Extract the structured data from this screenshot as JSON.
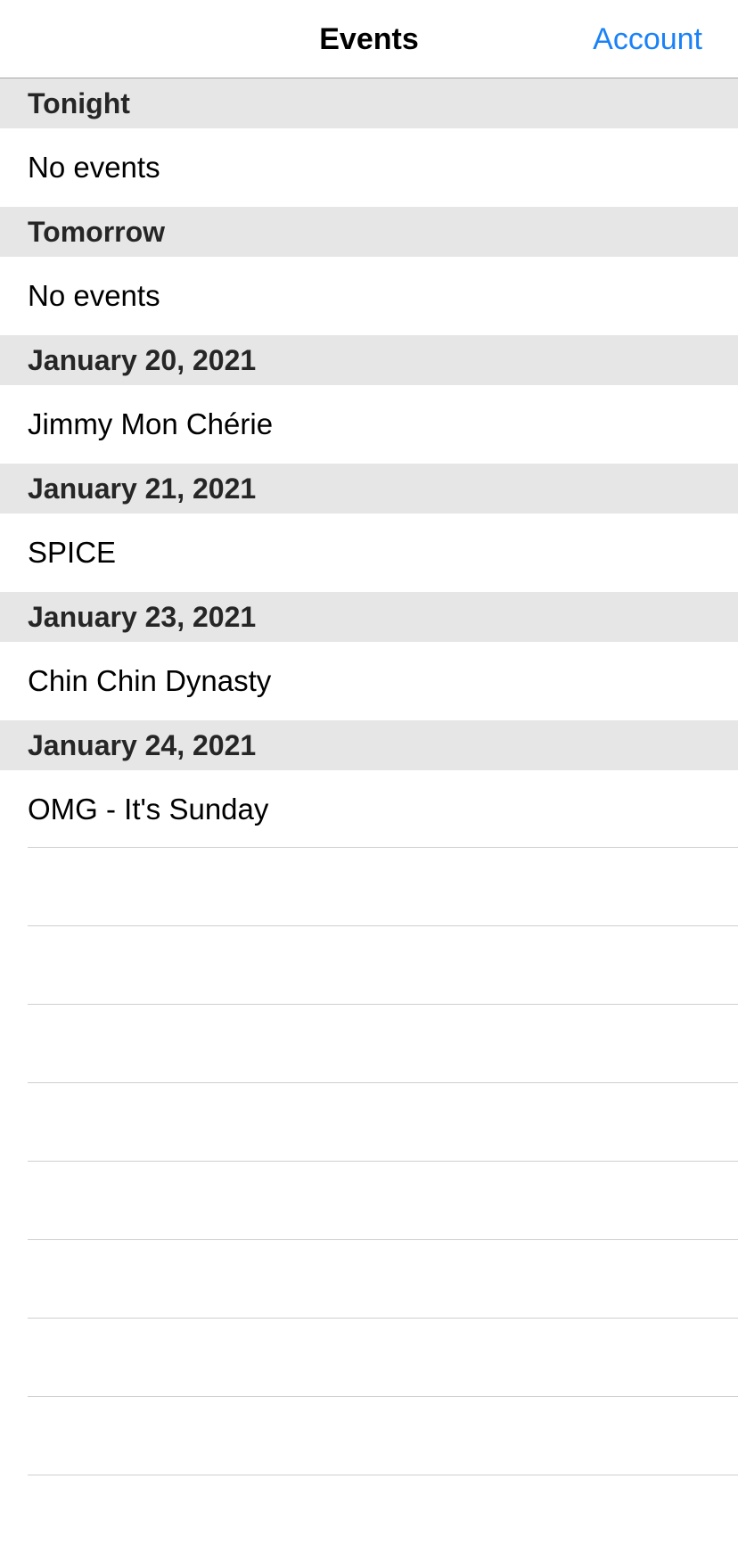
{
  "nav": {
    "title": "Events",
    "account_label": "Account"
  },
  "sections": [
    {
      "header": "Tonight",
      "rows": [
        "No events"
      ]
    },
    {
      "header": "Tomorrow",
      "rows": [
        "No events"
      ]
    },
    {
      "header": "January 20, 2021",
      "rows": [
        "Jimmy Mon Chérie"
      ]
    },
    {
      "header": "January 21, 2021",
      "rows": [
        "SPICE"
      ]
    },
    {
      "header": "January 23, 2021",
      "rows": [
        "Chin Chin Dynasty"
      ]
    },
    {
      "header": "January 24, 2021",
      "rows": [
        "OMG - It's Sunday"
      ]
    }
  ],
  "colors": {
    "accent": "#1a82f7",
    "section_header_bg": "#e6e6e6",
    "separator": "#cfcfd3"
  }
}
